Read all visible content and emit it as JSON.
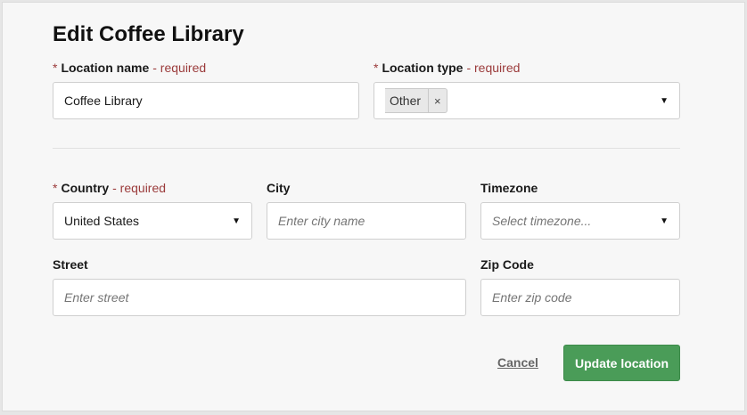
{
  "form": {
    "title": "Edit Coffee Library",
    "required_marker": "*",
    "required_text": "- required",
    "location_name": {
      "label": "Location name",
      "value": "Coffee Library"
    },
    "location_type": {
      "label": "Location type",
      "chip": "Other",
      "chip_remove": "×"
    },
    "country": {
      "label": "Country",
      "value": "United States"
    },
    "city": {
      "label": "City",
      "placeholder": "Enter city name"
    },
    "timezone": {
      "label": "Timezone",
      "placeholder": "Select timezone..."
    },
    "street": {
      "label": "Street",
      "placeholder": "Enter street"
    },
    "zip": {
      "label": "Zip Code",
      "placeholder": "Enter zip code"
    },
    "caret": "▼",
    "cancel_label": "Cancel",
    "submit_label": "Update location"
  }
}
